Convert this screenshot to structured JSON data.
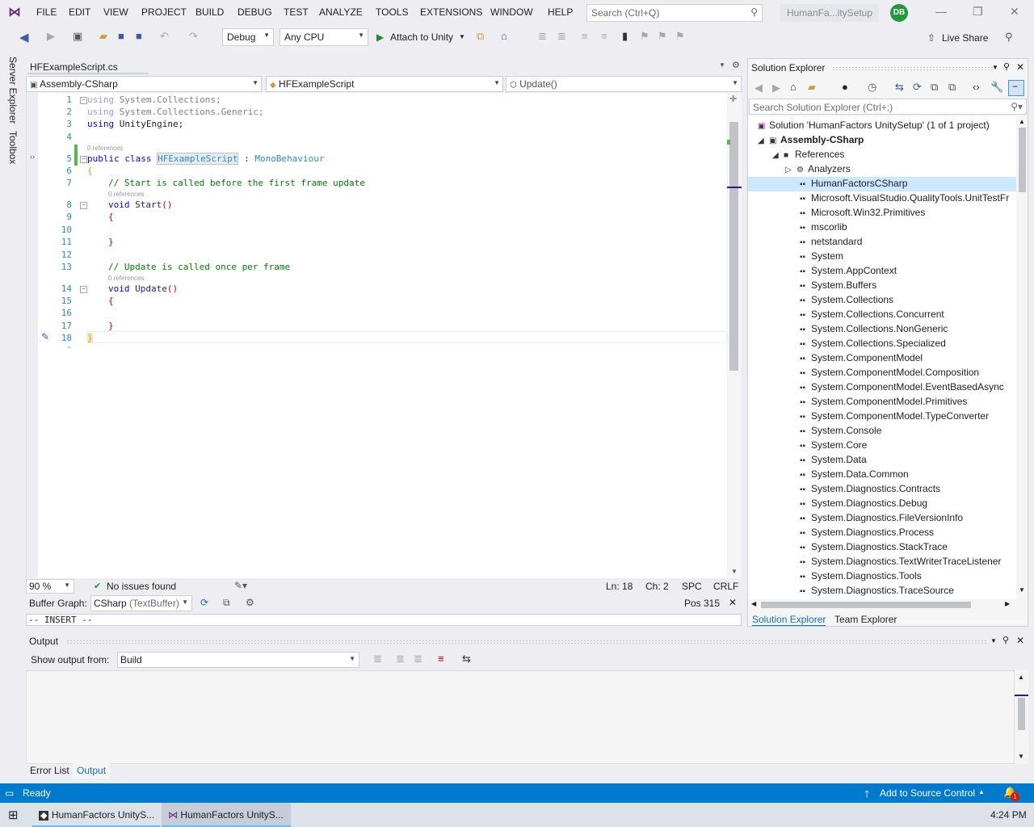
{
  "menu": [
    "FILE",
    "EDIT",
    "VIEW",
    "PROJECT",
    "BUILD",
    "DEBUG",
    "TEST",
    "ANALYZE",
    "TOOLS",
    "EXTENSIONS",
    "WINDOW",
    "HELP"
  ],
  "search": {
    "placeholder": "Search (Ctrl+Q)"
  },
  "solution_title": "HumanFa...itySetup",
  "avatar_initials": "DB",
  "toolbar": {
    "config": "Debug",
    "platform": "Any CPU",
    "attach": "Attach to Unity",
    "live_share": "Live Share"
  },
  "left_tabs": {
    "server_explorer": "Server Explorer",
    "toolbox": "Toolbox"
  },
  "editor": {
    "tab": "HFExampleScript.cs",
    "nav_project": "Assembly-CSharp",
    "nav_type": "HFExampleScript",
    "nav_member": "Update()",
    "refs": "0 references",
    "lines": {
      "l1_kw": "using",
      "l1_rest": "System.Collections;",
      "l2_kw": "using",
      "l2_rest": "System.Collections.Generic;",
      "l3_kw": "using",
      "l3_rest": "UnityEngine;",
      "l5_kw1": "public",
      "l5_kw2": "class",
      "l5_name": "HFExampleScript",
      "l5_colon": ":",
      "l5_base": "MonoBehaviour",
      "l6": "{",
      "l7": "// Start is called before the first frame update",
      "l8_kw": "void",
      "l8_name": "Start",
      "l8_paren": "()",
      "l9": "{",
      "l11": "}",
      "l13": "// Update is called once per frame",
      "l14_kw": "void",
      "l14_name": "Update",
      "l14_paren": "()",
      "l15": "{",
      "l17": "}",
      "l18": "}"
    },
    "line_numbers": [
      "1",
      "2",
      "3",
      "4",
      "5",
      "6",
      "7",
      "8",
      "9",
      "10",
      "11",
      "12",
      "13",
      "14",
      "15",
      "16",
      "17",
      "18"
    ],
    "zoom": "90 %",
    "issues": "No issues found",
    "ln": "Ln: 18",
    "ch": "Ch: 2",
    "spc": "SPC",
    "crlf": "CRLF",
    "buffer_label": "Buffer Graph:",
    "buffer_value": "CSharp",
    "buffer_kind": "(TextBuffer)",
    "pos": "Pos 315",
    "insert": "-- INSERT --"
  },
  "solution_explorer": {
    "title": "Solution Explorer",
    "search_placeholder": "Search Solution Explorer (Ctrl+;)",
    "solution": "Solution 'HumanFactors UnitySetup' (1 of 1 project)",
    "project": "Assembly-CSharp",
    "references": "References",
    "analyzers": "Analyzers",
    "refs": [
      "HumanFactorsCSharp",
      "Microsoft.VisualStudio.QualityTools.UnitTestFr",
      "Microsoft.Win32.Primitives",
      "mscorlib",
      "netstandard",
      "System",
      "System.AppContext",
      "System.Buffers",
      "System.Collections",
      "System.Collections.Concurrent",
      "System.Collections.NonGeneric",
      "System.Collections.Specialized",
      "System.ComponentModel",
      "System.ComponentModel.Composition",
      "System.ComponentModel.EventBasedAsync",
      "System.ComponentModel.Primitives",
      "System.ComponentModel.TypeConverter",
      "System.Console",
      "System.Core",
      "System.Data",
      "System.Data.Common",
      "System.Diagnostics.Contracts",
      "System.Diagnostics.Debug",
      "System.Diagnostics.FileVersionInfo",
      "System.Diagnostics.Process",
      "System.Diagnostics.StackTrace",
      "System.Diagnostics.TextWriterTraceListener",
      "System.Diagnostics.Tools",
      "System.Diagnostics.TraceSource"
    ],
    "tab_se": "Solution Explorer",
    "tab_te": "Team Explorer"
  },
  "output": {
    "title": "Output",
    "show_from": "Show output from:",
    "source": "Build",
    "tab_errors": "Error List",
    "tab_output": "Output"
  },
  "status": {
    "ready": "Ready",
    "source_control": "Add to Source Control",
    "badge": "1"
  },
  "taskbar": {
    "item1": "HumanFactors UnityS...",
    "item2": "HumanFactors UnityS...",
    "time": "4:24 PM"
  },
  "colors": {
    "accent": "#007acc",
    "keyword": "#0000ff",
    "type": "#2b91af",
    "comment": "#008000"
  }
}
